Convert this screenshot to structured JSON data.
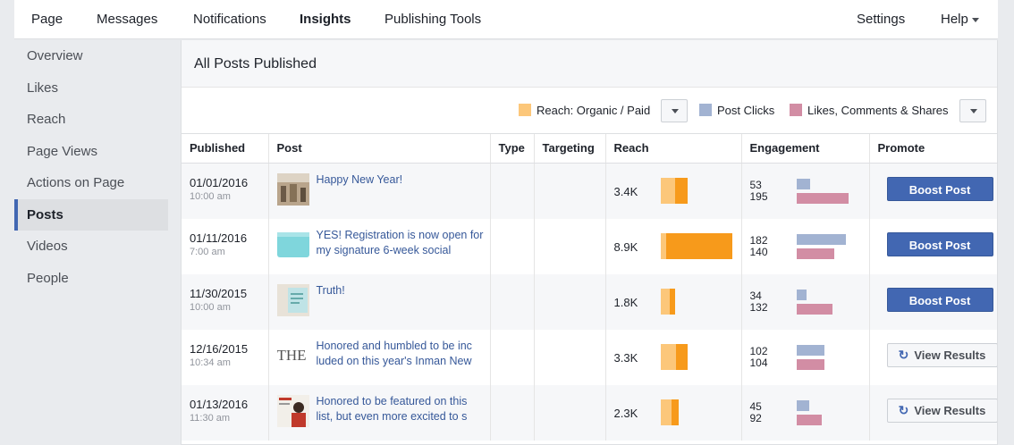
{
  "nav": {
    "items": [
      "Page",
      "Messages",
      "Notifications",
      "Insights",
      "Publishing Tools"
    ],
    "active": "Insights",
    "settings": "Settings",
    "help": "Help"
  },
  "sidebar": {
    "items": [
      "Overview",
      "Likes",
      "Reach",
      "Page Views",
      "Actions on Page",
      "Posts",
      "Videos",
      "People"
    ],
    "active": "Posts"
  },
  "main": {
    "title": "All Posts Published"
  },
  "legend": {
    "reach": "Reach: Organic / Paid",
    "clicks": "Post Clicks",
    "engagement": "Likes, Comments & Shares"
  },
  "colors": {
    "organic": "#fcc77a",
    "paid": "#f79a1b",
    "clicks": "#a2b3d2",
    "likes": "#d28da4",
    "boost": "#4267b2"
  },
  "table": {
    "headers": [
      "Published",
      "Post",
      "Type",
      "Targeting",
      "Reach",
      "Engagement",
      "Promote"
    ],
    "rows": [
      {
        "date": "01/01/2016",
        "time": "10:00 am",
        "post": "Happy New Year!",
        "reach": "3.4K",
        "clicks": "53",
        "likes": "195",
        "promote": "Boost Post"
      },
      {
        "date": "01/11/2016",
        "time": "7:00 am",
        "post": "YES! Registration is now open for my signature 6-week social",
        "reach": "8.9K",
        "clicks": "182",
        "likes": "140",
        "promote": "Boost Post"
      },
      {
        "date": "11/30/2015",
        "time": "10:00 am",
        "post": "Truth!",
        "reach": "1.8K",
        "clicks": "34",
        "likes": "132",
        "promote": "Boost Post"
      },
      {
        "date": "12/16/2015",
        "time": "10:34 am",
        "post": "Honored and humbled to be inc luded on this year's Inman New",
        "thumb_text": "THE",
        "reach": "3.3K",
        "clicks": "102",
        "likes": "104",
        "promote": "View Results"
      },
      {
        "date": "01/13/2016",
        "time": "11:30 am",
        "post": "Honored to be featured on this list, but even more excited to s",
        "reach": "2.3K",
        "clicks": "45",
        "likes": "92",
        "promote": "View Results"
      }
    ]
  }
}
